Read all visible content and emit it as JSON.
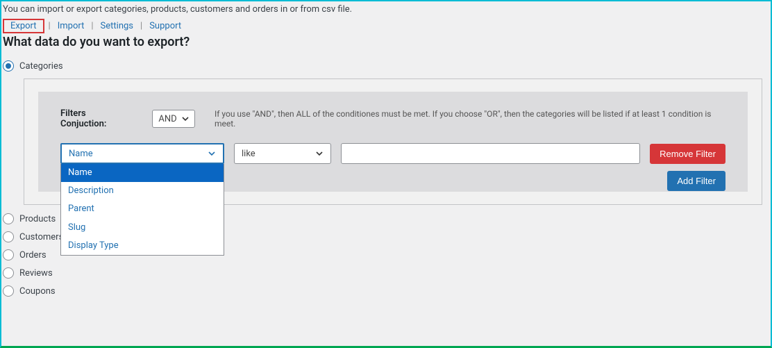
{
  "intro": "You can import or export categories, products, customers and orders in or from csv file.",
  "tabs": {
    "export": "Export",
    "import": "Import",
    "settings": "Settings",
    "support": "Support"
  },
  "page_title": "What data do you want to export?",
  "radios": {
    "categories": "Categories",
    "products": "Products",
    "customers": "Customers",
    "orders": "Orders",
    "reviews": "Reviews",
    "coupons": "Coupons"
  },
  "filter": {
    "conjuction_label": "Filters Conjuction:",
    "conjuction_value": "AND",
    "hint": "If you use \"AND\", then ALL of the conditiones must be met. If you choose \"OR\", then the categories will be listed if at least 1 condition is meet.",
    "field_value": "Name",
    "operator_value": "like",
    "text_value": "",
    "remove_label": "Remove Filter",
    "add_label": "Add Filter",
    "options": {
      "name": "Name",
      "description": "Description",
      "parent": "Parent",
      "slug": "Slug",
      "display_type": "Display Type"
    }
  }
}
